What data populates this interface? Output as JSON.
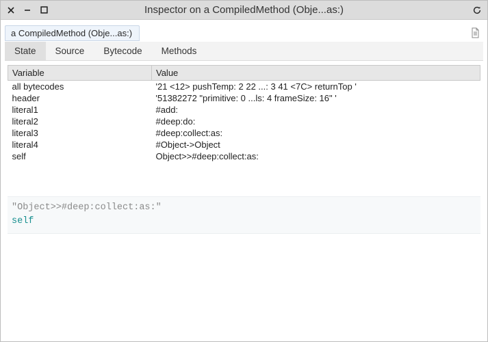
{
  "window": {
    "title": "Inspector on a CompiledMethod (Obje...as:)"
  },
  "breadcrumb": {
    "label": "a CompiledMethod (Obje...as:)"
  },
  "tabs": {
    "items": [
      {
        "label": "State",
        "active": true
      },
      {
        "label": "Source",
        "active": false
      },
      {
        "label": "Bytecode",
        "active": false
      },
      {
        "label": "Methods",
        "active": false
      }
    ]
  },
  "table": {
    "headers": {
      "variable": "Variable",
      "value": "Value"
    },
    "rows": [
      {
        "variable": "all bytecodes",
        "value": "'21 <12> pushTemp: 2 22 ...: 3 41 <7C> returnTop '"
      },
      {
        "variable": "header",
        "value": "'51382272 \"primitive: 0 ...ls: 4  frameSize: 16\" '"
      },
      {
        "variable": "literal1",
        "value": "#add:"
      },
      {
        "variable": "literal2",
        "value": "#deep:do:"
      },
      {
        "variable": "literal3",
        "value": "#deep:collect:as:"
      },
      {
        "variable": "literal4",
        "value": "#Object->Object"
      },
      {
        "variable": "self",
        "value": "Object>>#deep:collect:as:"
      }
    ]
  },
  "code": {
    "comment": "\"Object>>#deep:collect:as:\"",
    "body": "self"
  }
}
